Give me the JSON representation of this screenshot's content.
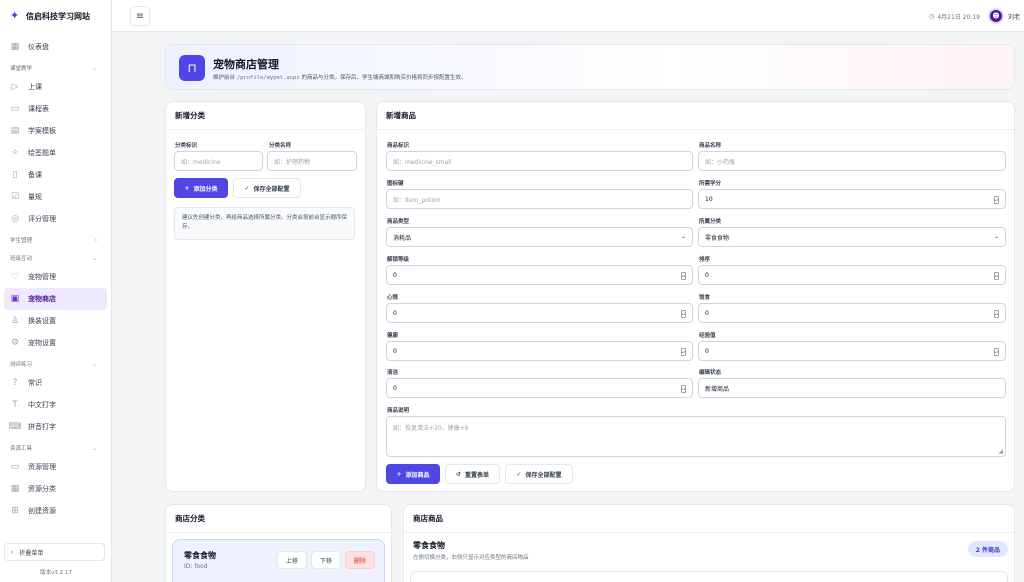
{
  "sidebar": {
    "brand": "信启科技学习网站",
    "dashboard": "仪表盘",
    "sections": {
      "course": "课堂教学",
      "student": "学生管理",
      "interact": "班级互动",
      "practice": "测评练习",
      "resource": "资源工具"
    },
    "course_items": [
      "上课",
      "课程表",
      "学案模板",
      "绘签题单",
      "备课",
      "量规",
      "评分管理"
    ],
    "interact_items": [
      "宠物管理",
      "宠物商店",
      "换装设置",
      "宠物设置"
    ],
    "practice_items": [
      "常识",
      "中文打字",
      "拼音打字"
    ],
    "resource_items": [
      "资源管理",
      "资源分类",
      "创建资源"
    ],
    "collapse": "折叠菜单",
    "version": "版本v3.2.17"
  },
  "topbar": {
    "datetime": "4月21日 20:19",
    "user": "刘老"
  },
  "header": {
    "title": "宠物商店管理",
    "desc_prefix": "维护前台",
    "desc_path": "/profile/mypet.aspx",
    "desc_suffix": "的商品与分类。保存后，学生端商城和购买价格将同步按配置生效。"
  },
  "new_category": {
    "title": "新增分类",
    "id_label": "分类标识",
    "id_placeholder": "如：medicine",
    "name_label": "分类名称",
    "name_placeholder": "如：护理药物",
    "add_btn": "添加分类",
    "save_btn": "保存全部配置",
    "tip": "建议先创建分类，再给商品选择所属分类。分类会按前台显示顺序保存。"
  },
  "new_goods": {
    "title": "新增商品",
    "fields": {
      "code_label": "商品标识",
      "code_placeholder": "如：medicine_small",
      "name_label": "商品名称",
      "name_placeholder": "如：小药瓶",
      "icon_label": "图标键",
      "icon_placeholder": "如：item_potion",
      "price_label": "所需学分",
      "price_value": "10",
      "type_label": "商品类型",
      "type_value": "消耗品",
      "cat_label": "所属分类",
      "cat_value": "零食食物",
      "level_label": "解锁等级",
      "level_value": "0",
      "sort_label": "排序",
      "sort_value": "0",
      "mood_label": "心情",
      "mood_value": "0",
      "hunger_label": "饱食",
      "hunger_value": "0",
      "health_label": "健康",
      "health_value": "0",
      "exp_label": "经验值",
      "exp_value": "0",
      "clean_label": "清洁",
      "clean_value": "0",
      "status_label": "编辑状态",
      "status_value": "新增商品",
      "desc_label": "商品说明",
      "desc_placeholder": "如：恢复清洁+20，健康+6"
    },
    "add_btn": "添加商品",
    "reset_btn": "重置表单",
    "save_btn": "保存全部配置"
  },
  "shop_categories": {
    "title": "商店分类",
    "item": {
      "name": "零食食物",
      "id": "ID: food",
      "up": "上移",
      "down": "下移",
      "delete": "删除"
    }
  },
  "shop_goods": {
    "title": "商店商品",
    "category": "零食食物",
    "sub": "左侧切换分类，右侧只显示对应类型的商店物品",
    "count": "2 件商品"
  }
}
